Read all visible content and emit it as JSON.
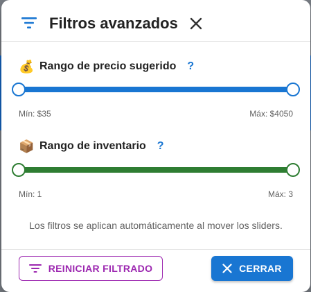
{
  "dialog": {
    "title": "Filtros avanzados",
    "icons": {
      "title_icon": "filter-list-icon",
      "close_icon": "close-icon"
    }
  },
  "price_range": {
    "emoji": "💰",
    "icon": "money-bag-icon",
    "label": "Rango de precio sugerido",
    "help": "?",
    "min_label": "Mín: $35",
    "max_label": "Máx: $4050",
    "selected_fraction": [
      0,
      1
    ],
    "color": "#1976d2"
  },
  "inventory_range": {
    "emoji": "📦",
    "icon": "package-icon",
    "label": "Rango de inventario",
    "help": "?",
    "min_label": "Mín: 1",
    "max_label": "Máx: 3",
    "selected_fraction": [
      0,
      1
    ],
    "color": "#2e7d32"
  },
  "hint": "Los filtros se aplican automáticamente al mover los sliders.",
  "footer": {
    "reset_label": "REINICIAR FILTRADO",
    "reset_icon": "filter-list-icon",
    "close_label": "CERRAR",
    "close_icon": "close-icon"
  },
  "colors": {
    "accent": "#1976d2",
    "secondary": "#9c27b0",
    "success": "#2e7d32",
    "help": "#1976d2"
  }
}
